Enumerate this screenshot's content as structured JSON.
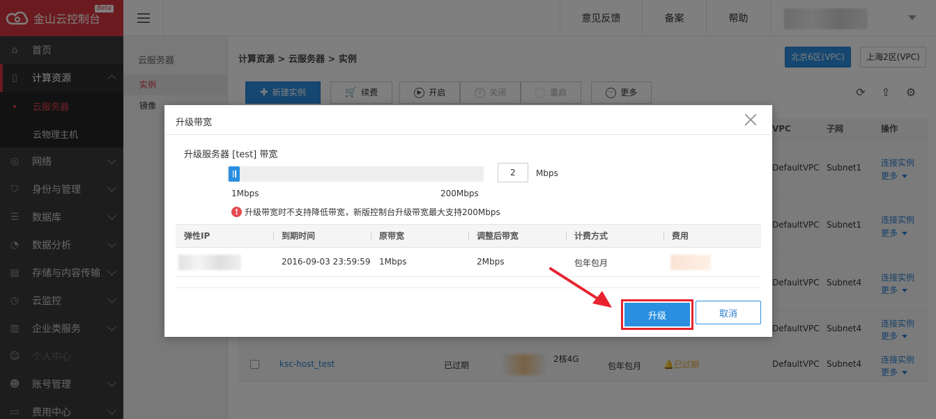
{
  "app": {
    "title": "金山云控制台",
    "badge": "Beta"
  },
  "topbar": {
    "feedback": "意见反馈",
    "filing": "备案",
    "help": "帮助"
  },
  "sidebar": {
    "items": [
      {
        "label": "首页",
        "icon": "home-icon"
      },
      {
        "label": "计算资源",
        "icon": "server-icon"
      },
      {
        "label": "网络",
        "icon": "network-icon"
      },
      {
        "label": "身份与管理",
        "icon": "shield-icon"
      },
      {
        "label": "数据库",
        "icon": "database-icon"
      },
      {
        "label": "数据分析",
        "icon": "analytics-icon"
      },
      {
        "label": "存储与内容传输",
        "icon": "storage-icon"
      },
      {
        "label": "云监控",
        "icon": "monitor-icon"
      },
      {
        "label": "企业类服务",
        "icon": "enterprise-icon"
      },
      {
        "label": "个人中心",
        "icon": "user-icon"
      },
      {
        "label": "账号管理",
        "icon": "users-icon"
      },
      {
        "label": "费用中心",
        "icon": "wallet-icon"
      }
    ],
    "sub_items": [
      "云服务器",
      "云物理主机"
    ]
  },
  "subnav": {
    "title": "云服务器",
    "items": [
      "实例",
      "镜像"
    ]
  },
  "breadcrumb": "计算资源 > 云服务器 > 实例",
  "regions": [
    "北京6区(VPC)",
    "上海2区(VPC)"
  ],
  "toolbar": {
    "create": "新建实例",
    "renew": "续费",
    "start": "开启",
    "stop": "关闭",
    "restart": "重启",
    "more": "更多"
  },
  "table": {
    "headers": {
      "vpc": "VPC",
      "subnet": "子网",
      "ops": "操作"
    },
    "rows": [
      {
        "vpc": "DefaultVPC",
        "subnet": "Subnet1",
        "connect": "连接实例",
        "more": "更多"
      },
      {
        "vpc": "DefaultVPC",
        "subnet": "Subnet1",
        "connect": "连接实例",
        "more": "更多"
      },
      {
        "vpc": "DefaultVPC",
        "subnet": "Subnet4",
        "connect": "连接实例",
        "more": "更多"
      },
      {
        "vpc": "DefaultVPC",
        "subnet": "Subnet4",
        "connect": "连接实例",
        "more": "更多"
      },
      {
        "name": "ksc-host_test",
        "status": "已过期",
        "spec": "2核4G",
        "billing": "包年包月",
        "expiry": "已过期",
        "vpc": "DefaultVPC",
        "subnet": "Subnet4",
        "connect": "连接实例",
        "more": "更多"
      }
    ]
  },
  "modal": {
    "title": "升级带宽",
    "label": "升级服务器 [test] 带宽",
    "slider": {
      "min": 1,
      "max": 200,
      "value": 2
    },
    "input_value": "2",
    "unit": "Mbps",
    "min_label": "1Mbps",
    "max_label": "200Mbps",
    "warning": "升级带宽时不支持降低带宽，新版控制台升级带宽最大支持200Mbps",
    "columns": [
      "弹性IP",
      "到期时间",
      "原带宽",
      "调整后带宽",
      "计费方式",
      "费用"
    ],
    "row": {
      "expire": "2016-09-03 23:59:59",
      "old_bw": "1Mbps",
      "new_bw": "2Mbps",
      "billing": "包年包月"
    },
    "upgrade_button": "升级",
    "cancel_button": "取消"
  },
  "colors": {
    "brand": "#d7363f",
    "primary": "#2a8fe0",
    "highlight": "#e8232f"
  }
}
